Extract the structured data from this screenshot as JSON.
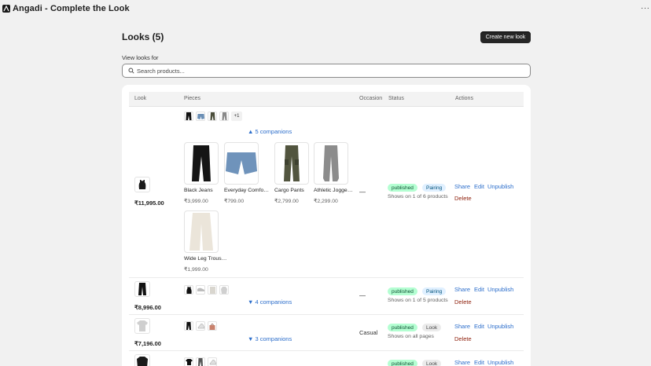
{
  "app": {
    "title": "Angadi - Complete the Look"
  },
  "page": {
    "title": "Looks (5)",
    "create_label": "Create new look"
  },
  "filter": {
    "label": "View looks for",
    "placeholder": "Search products..."
  },
  "table": {
    "headers": [
      "Look",
      "Pieces",
      "Occasion",
      "Status",
      "Actions"
    ]
  },
  "looks": [
    {
      "price": "₹11,995.00",
      "more_count": "+1",
      "companions": "▲ 5 companions",
      "products": [
        {
          "name": "Black Jeans",
          "price": "₹3,999.00"
        },
        {
          "name": "Everyday Comfo…",
          "price": "₹799.00"
        },
        {
          "name": "Cargo Pants",
          "price": "₹2,799.00"
        },
        {
          "name": "Athletic Jogge…",
          "price": "₹2,299.00"
        },
        {
          "name": "Wide Leg Trous…",
          "price": "₹1,999.00"
        }
      ],
      "occasion": "—",
      "status": "published",
      "type": "Pairing",
      "shows": "Shows on 1 of 6 products"
    },
    {
      "price": "₹8,996.00",
      "companions": "▼ 4 companions",
      "occasion": "—",
      "status": "published",
      "type": "Pairing",
      "shows": "Shows on 1 of 5 products"
    },
    {
      "price": "₹7,196.00",
      "companions": "▼ 3 companions",
      "occasion": "Casual",
      "status": "published",
      "type": "Look",
      "shows": "Shows on all pages"
    },
    {
      "status": "published",
      "type": "Look"
    }
  ],
  "actions": {
    "share": "Share",
    "edit": "Edit",
    "unpublish": "Unpublish",
    "delete": "Delete"
  }
}
